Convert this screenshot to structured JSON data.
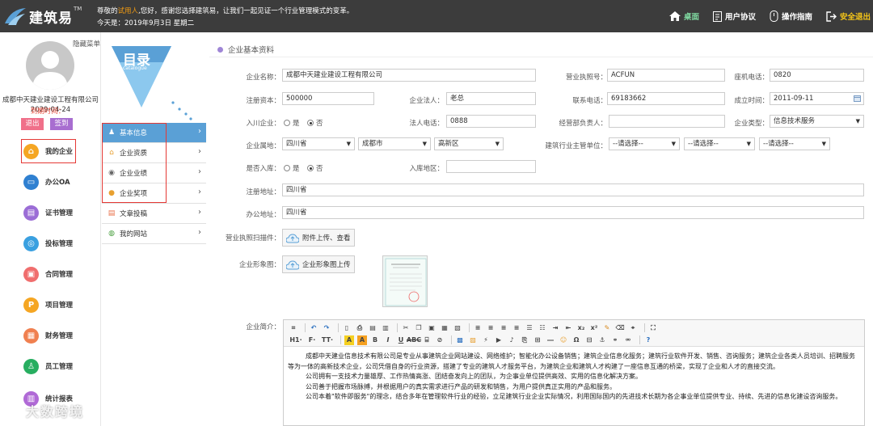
{
  "topbar": {
    "logo_text": "建筑易",
    "logo_tm": "TM",
    "greeting_prefix": "尊敬的",
    "greeting_highlight": "试用人",
    "greeting_suffix": ",您好，感谢您选择建筑易，让我们一起见证一个行业管理模式的变革。",
    "today": "今天是：2019年9月3日 星期二",
    "nav": [
      {
        "label": "桌面",
        "icon": "home-icon"
      },
      {
        "label": "用户协议",
        "icon": "document-icon"
      },
      {
        "label": "操作指南",
        "icon": "guide-icon"
      },
      {
        "label": "安全退出",
        "icon": "logout-icon"
      }
    ]
  },
  "sidebar": {
    "hide_menu": "隐藏菜单",
    "company": "成都中天建业建设工程有限公司",
    "expire_label": "到期时间：",
    "expire_date": "2029-04-24",
    "logout": "退出",
    "checkin": "签到",
    "items": [
      {
        "label": "我的企业",
        "icon": "enterprise-icon",
        "color": "#f5a623"
      },
      {
        "label": "办公OA",
        "icon": "monitor-icon",
        "color": "#2f80d1"
      },
      {
        "label": "证书管理",
        "icon": "certificate-icon",
        "color": "#9b6dd6"
      },
      {
        "label": "投标管理",
        "icon": "bid-icon",
        "color": "#3aa0e0"
      },
      {
        "label": "合同管理",
        "icon": "contract-icon",
        "color": "#f06e6e"
      },
      {
        "label": "项目管理",
        "icon": "project-icon",
        "color": "#f5a623"
      },
      {
        "label": "财务管理",
        "icon": "finance-icon",
        "color": "#f08050"
      },
      {
        "label": "员工管理",
        "icon": "staff-icon",
        "color": "#27ae60"
      },
      {
        "label": "统计报表",
        "icon": "report-icon",
        "color": "#b06ad6"
      }
    ]
  },
  "catalog": {
    "title": "目录",
    "subtitle": "catalogue",
    "items": [
      {
        "label": "基本信息",
        "icon": "basic-info-icon"
      },
      {
        "label": "企业资质",
        "icon": "qualification-icon"
      },
      {
        "label": "企业业绩",
        "icon": "performance-icon"
      },
      {
        "label": "企业奖项",
        "icon": "award-icon"
      },
      {
        "label": "文章投稿",
        "icon": "article-icon"
      },
      {
        "label": "我的网站",
        "icon": "website-icon"
      }
    ]
  },
  "form": {
    "section_title": "企业基本资料",
    "company_name_label": "企业名称：",
    "company_name": "成都中天建业建设工程有限公司",
    "license_no_label": "营业执照号：",
    "license_no": "ACFUN",
    "landline_label": "座机电话：",
    "landline": "0820",
    "capital_label": "注册资本：",
    "capital": "500000",
    "legal_person_label": "企业法人：",
    "legal_person": "老总",
    "contact_phone_label": "联系电话：",
    "contact_phone": "69183662",
    "founded_label": "成立时间：",
    "founded": "2011-09-11",
    "joined_label": "入川企业：",
    "yes": "是",
    "no": "否",
    "legal_phone_label": "法人电话：",
    "legal_phone": "0888",
    "manager_label": "经营部负责人：",
    "manager": "",
    "type_label": "企业类型：",
    "type": "信息技术服务",
    "location_label": "企业属地：",
    "province": "四川省",
    "city": "成都市",
    "district": "高新区",
    "authority_label": "建筑行业主管单位：",
    "authority_sel_1": "--请选择--",
    "authority_sel_2": "--请选择--",
    "authority_sel_3": "--请选择--",
    "in_db_label": "是否入库：",
    "db_region_label": "入库地区：",
    "db_region": "",
    "reg_address_label": "注册地址：",
    "reg_address": "四川省",
    "office_address_label": "办公地址：",
    "office_address": "四川省",
    "license_scan_label": "营业执照扫描件：",
    "license_scan_btn": "附件上传、查看",
    "image_label": "企业形象图：",
    "image_btn": "企业形象图上传",
    "intro_label": "企业简介："
  },
  "editor": {
    "toolbar_row2_labels": [
      "H1·",
      "F·",
      "TT·"
    ],
    "paragraphs": [
      "成都中天建业信息技术有限公司是专业从事建筑企业网站建设、网络维护；智能化办公设备销售；建筑企业信息化服务；建筑行业软件开发、销售、咨询服务；建筑企业各类人员培训、招聘服务等为一体的高新技术企业，公司凭借自身的行业资源，搭建了专业的建筑人才服务平台，为建筑企业和建筑人才构建了一座信息互通的桥梁，实现了企业和人才的直接交流。",
      "公司拥有一支技术力量雄厚、工作热情高涨、团结奋发向上的团队，为企事业单位提供高效、实用的信息化解决方案。",
      "公司善于把握市场脉搏，并根据用户的真实需求进行产品的研发和销售，为用户提供真正实用的产品和服务。",
      "公司本着\"软件即服务\"的理念，结合多年在管理软件行业的经验，立足建筑行业企业实际情况，利用国际国内的先进技术长期为各企事业单位提供专业、持续、先进的信息化建设咨询服务。"
    ]
  },
  "watermark": "大数跨境"
}
